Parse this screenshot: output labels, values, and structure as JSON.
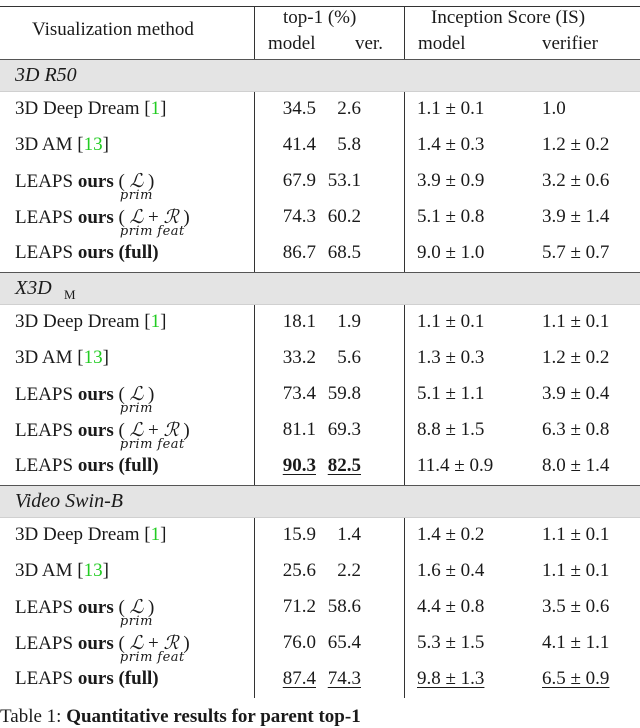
{
  "table": {
    "header": {
      "method": "Visualization method",
      "top1_group": "top-1 (%)",
      "is_group": "Inception Score (IS)",
      "top1_model": "model",
      "top1_ver": "ver.",
      "is_model": "model",
      "is_verifier": "verifier"
    },
    "sections": [
      {
        "title": "3D R50",
        "title_sub": "",
        "rows": [
          {
            "name": "3D Deep Dream",
            "ref": "1",
            "top1_model": "34.5",
            "top1_ver": "2.6",
            "is_model": "1.1 ± 0.1",
            "is_verifier": "1.0"
          },
          {
            "name": "3D AM",
            "ref": "13",
            "top1_model": "41.4",
            "top1_ver": "5.8",
            "is_model": "1.4 ± 0.3",
            "is_verifier": "1.2 ± 0.2"
          },
          {
            "name": "LEAPS",
            "bold": "ours",
            "variant": "L_prim",
            "top1_model": "67.9",
            "top1_ver": "53.1",
            "is_model": "3.9 ± 0.9",
            "is_verifier": "3.2 ± 0.6"
          },
          {
            "name": "LEAPS",
            "bold": "ours",
            "variant": "L_prim + R_feat",
            "top1_model": "74.3",
            "top1_ver": "60.2",
            "is_model": "5.1 ± 0.8",
            "is_verifier": "3.9 ± 1.4"
          },
          {
            "name": "LEAPS",
            "bold": "ours (full)",
            "variant": "full",
            "top1_model": "86.7",
            "top1_ver": "68.5",
            "is_model": "9.0 ± 1.0",
            "is_verifier": "5.7 ± 0.7"
          }
        ]
      },
      {
        "title": "X3D",
        "title_sub": "M",
        "rows": [
          {
            "name": "3D Deep Dream",
            "ref": "1",
            "top1_model": "18.1",
            "top1_ver": "1.9",
            "is_model": "1.1 ± 0.1",
            "is_verifier": "1.1 ± 0.1"
          },
          {
            "name": "3D AM",
            "ref": "13",
            "top1_model": "33.2",
            "top1_ver": "5.6",
            "is_model": "1.3 ± 0.3",
            "is_verifier": "1.2 ± 0.2"
          },
          {
            "name": "LEAPS",
            "bold": "ours",
            "variant": "L_prim",
            "top1_model": "73.4",
            "top1_ver": "59.8",
            "is_model": "5.1 ± 1.1",
            "is_verifier": "3.9 ± 0.4"
          },
          {
            "name": "LEAPS",
            "bold": "ours",
            "variant": "L_prim + R_feat",
            "top1_model": "81.1",
            "top1_ver": "69.3",
            "is_model": "8.8 ± 1.5",
            "is_verifier": "6.3 ± 0.8"
          },
          {
            "name": "LEAPS",
            "bold": "ours (full)",
            "variant": "full",
            "top1_model": "90.3",
            "top1_ver": "82.5",
            "is_model": "11.4 ± 0.9",
            "is_verifier": "8.0 ± 1.4",
            "emph": "bold-underline-top1"
          }
        ]
      },
      {
        "title": "Video Swin-B",
        "title_sub": "",
        "rows": [
          {
            "name": "3D Deep Dream",
            "ref": "1",
            "top1_model": "15.9",
            "top1_ver": "1.4",
            "is_model": "1.4 ± 0.2",
            "is_verifier": "1.1 ± 0.1"
          },
          {
            "name": "3D AM",
            "ref": "13",
            "top1_model": "25.6",
            "top1_ver": "2.2",
            "is_model": "1.6 ± 0.4",
            "is_verifier": "1.1 ± 0.1"
          },
          {
            "name": "LEAPS",
            "bold": "ours",
            "variant": "L_prim",
            "top1_model": "71.2",
            "top1_ver": "58.6",
            "is_model": "4.4 ± 0.8",
            "is_verifier": "3.5 ± 0.6"
          },
          {
            "name": "LEAPS",
            "bold": "ours",
            "variant": "L_prim + R_feat",
            "top1_model": "76.0",
            "top1_ver": "65.4",
            "is_model": "5.3 ± 1.5",
            "is_verifier": "4.1 ± 1.1"
          },
          {
            "name": "LEAPS",
            "bold": "ours (full)",
            "variant": "full",
            "top1_model": "87.4",
            "top1_ver": "74.3",
            "is_model": "9.8 ± 1.3",
            "is_verifier": "6.5 ± 0.9",
            "emph": "underline-all"
          }
        ]
      }
    ],
    "math": {
      "L": "ℒ",
      "R": "ℛ",
      "prim": "prim",
      "feat": "feat",
      "plus": "+"
    },
    "ref_color": "#22cc22",
    "section_bg": "#e4e4e4"
  },
  "caption": {
    "prefix": "Table 1:",
    "text": "Quantitative results for parent top-1"
  }
}
